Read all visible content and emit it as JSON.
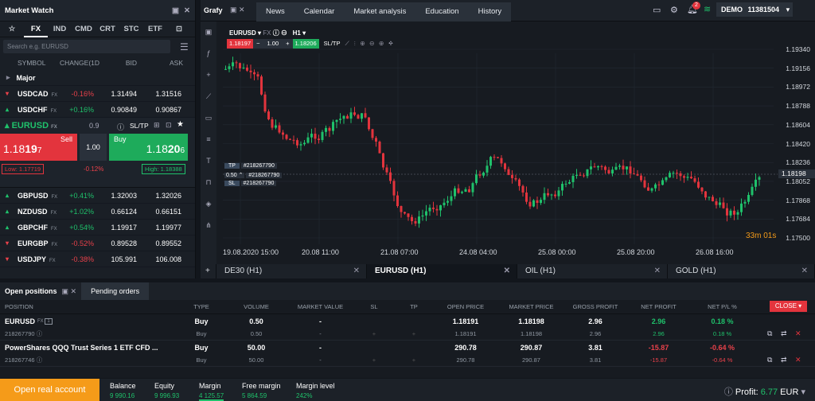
{
  "mw": {
    "title": "Market Watch",
    "tabs": [
      "☆",
      "FX",
      "IND",
      "CMD",
      "CRT",
      "STC",
      "ETF"
    ],
    "search_placeholder": "Search e.g. EURUSD",
    "cols": [
      "SYMBOL",
      "CHANGE(1D",
      "BID",
      "ASK"
    ],
    "group": "Major",
    "rows": [
      {
        "sym": "USDCAD",
        "chg": "-0.16%",
        "bid": "1.31494",
        "ask": "1.31516",
        "up": false
      },
      {
        "sym": "USDCHF",
        "chg": "+0.16%",
        "bid": "0.90849",
        "ask": "0.90867",
        "up": true
      }
    ],
    "exp": {
      "sym": "EURUSD",
      "spread": "0.9",
      "sltp": "SL/TP",
      "sell": "Sell",
      "buy": "Buy",
      "sell_price_a": "1.18",
      "sell_price_b": "19",
      "sell_price_c": "7",
      "buy_price_a": "1.18",
      "buy_price_b": "20",
      "buy_price_c": "6",
      "vol": "1.00",
      "low": "Low: 1.17719",
      "chg": "-0.12%",
      "high": "High: 1.18388"
    },
    "rows2": [
      {
        "sym": "GBPUSD",
        "chg": "+0.41%",
        "bid": "1.32003",
        "ask": "1.32026",
        "up": true
      },
      {
        "sym": "NZDUSD",
        "chg": "+1.02%",
        "bid": "0.66124",
        "ask": "0.66151",
        "up": true
      },
      {
        "sym": "GBPCHF",
        "chg": "+0.54%",
        "bid": "1.19917",
        "ask": "1.19977",
        "up": true
      },
      {
        "sym": "EURGBP",
        "chg": "-0.52%",
        "bid": "0.89528",
        "ask": "0.89552",
        "up": false
      },
      {
        "sym": "USDJPY",
        "chg": "-0.38%",
        "bid": "105.991",
        "ask": "106.008",
        "up": false
      }
    ]
  },
  "top": {
    "grafy": "Grafy",
    "nav": [
      "News",
      "Calendar",
      "Market analysis",
      "Education",
      "History"
    ],
    "account": "DEMO",
    "account_id": "11381504",
    "badge": "2"
  },
  "chart": {
    "symbol": "EURUSD",
    "fx": "FX",
    "tf": "H1",
    "sell": "1.18197",
    "vol": "1.00",
    "buy": "1.18206",
    "sltp": "SL/TP",
    "prices": [
      "1.19340",
      "1.19156",
      "1.18972",
      "1.18788",
      "1.18604",
      "1.18420",
      "1.18236",
      "1.18052",
      "1.17868",
      "1.17684",
      "1.17500"
    ],
    "current": "1.18198",
    "dates": [
      "19.08.2020 15:00",
      "20.08 11:00",
      "21.08 07:00",
      "24.08 04:00",
      "25.08 00:00",
      "25.08 20:00",
      "26.08 16:00"
    ],
    "timer": "33m 01s",
    "tp": "TP",
    "tp_id": "#218267790",
    "sl": "SL",
    "sl_id": "#218267790",
    "pos_vol": "0.50",
    "pos_id": "#218267790"
  },
  "ctabs": [
    "DE30 (H1)",
    "EURUSD (H1)",
    "OIL (H1)",
    "GOLD (H1)"
  ],
  "positions": {
    "tab1": "Open positions",
    "tab2": "Pending orders",
    "cols": [
      "POSITION",
      "TYPE",
      "VOLUME",
      "MARKET VALUE",
      "SL",
      "TP",
      "OPEN PRICE",
      "MARKET PRICE",
      "GROSS PROFIT",
      "NET PROFIT",
      "NET P/L %"
    ],
    "close": "CLOSE",
    "rows": [
      {
        "name": "EURUSD",
        "type": "Buy",
        "vol": "0.50",
        "mv": "-",
        "open": "1.18191",
        "market": "1.18198",
        "gross": "2.96",
        "net": "2.96",
        "pl": "0.18 %",
        "id": "218267790",
        "sub": {
          "type": "Buy",
          "vol": "0.50",
          "mv": "-",
          "open": "1.18191",
          "market": "1.18198",
          "gross": "2.96",
          "net": "2.96",
          "pl": "0.18 %"
        }
      },
      {
        "name": "PowerShares QQQ Trust Series 1 ETF CFD ...",
        "type": "Buy",
        "vol": "50.00",
        "mv": "-",
        "open": "290.78",
        "market": "290.87",
        "gross": "3.81",
        "net": "-15.87",
        "pl": "-0.64 %",
        "id": "218267746",
        "sub": {
          "type": "Buy",
          "vol": "50.00",
          "mv": "-",
          "open": "290.78",
          "market": "290.87",
          "gross": "3.81",
          "net": "-15.87",
          "pl": "-0.64 %"
        }
      }
    ]
  },
  "bottom": {
    "open_real": "Open real account",
    "stats": [
      {
        "l": "Balance",
        "v": "9 990.16"
      },
      {
        "l": "Equity",
        "v": "9 996.93"
      },
      {
        "l": "Margin",
        "v": "4 125.57"
      },
      {
        "l": "Free margin",
        "v": "5 864.59"
      },
      {
        "l": "Margin level",
        "v": "242%"
      }
    ],
    "profit_label": "Profit:",
    "profit": "6.77",
    "cur": "EUR"
  }
}
